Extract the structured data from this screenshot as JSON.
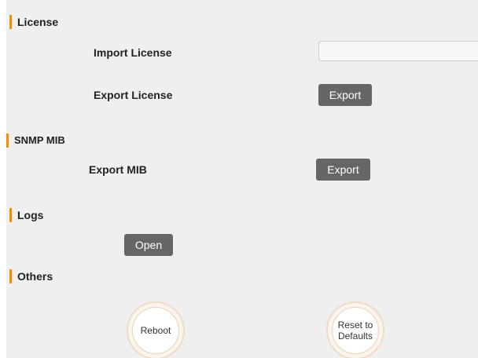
{
  "sections": {
    "license": {
      "title": "License",
      "import_label": "Import License",
      "export_label": "Export License",
      "export_button": "Export"
    },
    "snmp": {
      "title": "SNMP MIB",
      "export_label": "Export MIB",
      "export_button": "Export"
    },
    "logs": {
      "title": "Logs",
      "open_button": "Open"
    },
    "others": {
      "title": "Others",
      "reboot_button": "Reboot",
      "reset_button": "Reset to\nDefaults"
    }
  },
  "colors": {
    "accent": "#f39000",
    "button": "#666666",
    "panel": "#efefef"
  }
}
